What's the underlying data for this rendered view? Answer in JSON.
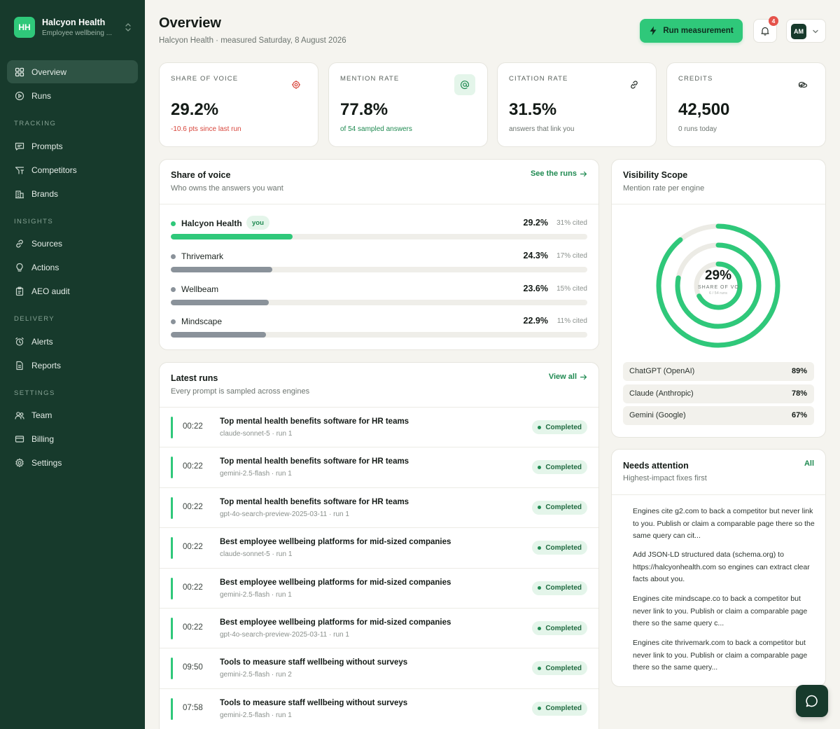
{
  "org": {
    "initials": "HH",
    "name": "Halcyon Health",
    "subtitle": "Employee wellbeing ..."
  },
  "nav": {
    "overview": "Overview",
    "runs": "Runs",
    "tracking_header": "TRACKING",
    "prompts": "Prompts",
    "competitors": "Competitors",
    "brands": "Brands",
    "insights_header": "INSIGHTS",
    "sources": "Sources",
    "actions": "Actions",
    "aeo_audit": "AEO audit",
    "delivery_header": "DELIVERY",
    "alerts": "Alerts",
    "reports": "Reports",
    "settings_header": "SETTINGS",
    "team": "Team",
    "billing": "Billing",
    "settings": "Settings"
  },
  "header": {
    "title": "Overview",
    "subtitle": "Halcyon Health · measured Saturday, 8 August 2026",
    "run_button": "Run measurement",
    "notification_count": "4",
    "avatar_initials": "AM"
  },
  "kpis": [
    {
      "label": "SHARE OF VOICE",
      "value": "29.2%",
      "note": "-10.6 pts since last run",
      "note_color": "#d8463c",
      "icon": "target-icon"
    },
    {
      "label": "MENTION RATE",
      "value": "77.8%",
      "note": "of 54 sampled answers",
      "note_color": "#1f8a51",
      "icon": "at-sign-icon"
    },
    {
      "label": "CITATION RATE",
      "value": "31.5%",
      "note": "answers that link you",
      "note_color": "#6d7570",
      "icon": "link-icon"
    },
    {
      "label": "CREDITS",
      "value": "42,500",
      "note": "0 runs today",
      "note_color": "#6d7570",
      "icon": "coins-icon"
    }
  ],
  "share_of_voice": {
    "title": "Share of voice",
    "subtitle": "Who owns the answers you want",
    "link": "See the runs",
    "you_badge": "you",
    "rows": [
      {
        "name": "Halcyon Health",
        "pct": "29.2%",
        "cited": "31% cited",
        "fill": 0.292,
        "color": "#2fc87a",
        "you": true
      },
      {
        "name": "Thrivemark",
        "pct": "24.3%",
        "cited": "17% cited",
        "fill": 0.243,
        "color": "#8a929a",
        "you": false
      },
      {
        "name": "Wellbeam",
        "pct": "23.6%",
        "cited": "15% cited",
        "fill": 0.236,
        "color": "#8a929a",
        "you": false
      },
      {
        "name": "Mindscape",
        "pct": "22.9%",
        "cited": "11% cited",
        "fill": 0.229,
        "color": "#8a929a",
        "you": false
      }
    ]
  },
  "runs": {
    "title": "Latest runs",
    "subtitle": "Every prompt is sampled across engines",
    "link": "View all",
    "items": [
      {
        "time": "00:22",
        "title": "Top mental health benefits software for HR teams",
        "meta": "claude-sonnet-5 · run 1",
        "status": "Completed"
      },
      {
        "time": "00:22",
        "title": "Top mental health benefits software for HR teams",
        "meta": "gemini-2.5-flash · run 1",
        "status": "Completed"
      },
      {
        "time": "00:22",
        "title": "Top mental health benefits software for HR teams",
        "meta": "gpt-4o-search-preview-2025-03-11 · run 1",
        "status": "Completed"
      },
      {
        "time": "00:22",
        "title": "Best employee wellbeing platforms for mid-sized companies",
        "meta": "claude-sonnet-5 · run 1",
        "status": "Completed"
      },
      {
        "time": "00:22",
        "title": "Best employee wellbeing platforms for mid-sized companies",
        "meta": "gemini-2.5-flash · run 1",
        "status": "Completed"
      },
      {
        "time": "00:22",
        "title": "Best employee wellbeing platforms for mid-sized companies",
        "meta": "gpt-4o-search-preview-2025-03-11 · run 1",
        "status": "Completed"
      },
      {
        "time": "09:50",
        "title": "Tools to measure staff wellbeing without surveys",
        "meta": "gemini-2.5-flash · run 2",
        "status": "Completed"
      },
      {
        "time": "07:58",
        "title": "Tools to measure staff wellbeing without surveys",
        "meta": "gemini-2.5-flash · run 1",
        "status": "Completed"
      }
    ]
  },
  "visibility": {
    "title": "Visibility Scope",
    "subtitle": "Mention rate per engine",
    "center_value": "29%",
    "center_label": "SHARE OF VOICE",
    "center_sub": "6 / 54 runs",
    "engines": [
      {
        "name": "ChatGPT (OpenAI)",
        "value": "89%",
        "rate": 0.89
      },
      {
        "name": "Claude (Anthropic)",
        "value": "78%",
        "rate": 0.78
      },
      {
        "name": "Gemini (Google)",
        "value": "67%",
        "rate": 0.67
      }
    ]
  },
  "attention": {
    "title": "Needs attention",
    "subtitle": "Highest-impact fixes first",
    "link": "All",
    "items": [
      "Engines cite g2.com to back a competitor but never link to you. Publish or claim a comparable page there so the same query can cit...",
      "Add JSON-LD structured data (schema.org) to https://halcyonhealth.com so engines can extract clear facts about you.",
      "Engines cite mindscape.co to back a competitor but never link to you. Publish or claim a comparable page there so the same query c...",
      "Engines cite thrivemark.com to back a competitor but never link to you. Publish or claim a comparable page there so the same query..."
    ]
  },
  "colors": {
    "accent": "#2fc87a",
    "sidebar": "#173a2c",
    "danger": "#d8463c",
    "link": "#1f8a51"
  }
}
